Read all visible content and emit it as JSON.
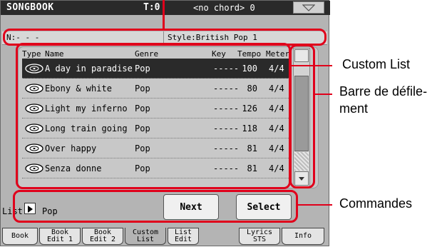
{
  "titlebar": {
    "title": "SONGBOOK",
    "tempo_letter": "T:",
    "tempo_value": "0",
    "chord": "<no chord> 0"
  },
  "infobar": {
    "n_label": "N:- - -",
    "style_label": "Style:British Pop 1"
  },
  "columns": {
    "type": "Type",
    "name": "Name",
    "genre": "Genre",
    "key": "Key",
    "tempo": "Tempo",
    "meter": "Meter"
  },
  "rows": [
    {
      "name": "A day in paradise",
      "genre": "Pop",
      "key": "-----",
      "tempo": "100",
      "meter": "4/4",
      "selected": true
    },
    {
      "name": "Ebony & white",
      "genre": "Pop",
      "key": "-----",
      "tempo": "80",
      "meter": "4/4",
      "selected": false
    },
    {
      "name": "Light my inferno",
      "genre": "Pop",
      "key": "-----",
      "tempo": "126",
      "meter": "4/4",
      "selected": false
    },
    {
      "name": "Long train going",
      "genre": "Pop",
      "key": "-----",
      "tempo": "118",
      "meter": "4/4",
      "selected": false
    },
    {
      "name": "Over happy",
      "genre": "Pop",
      "key": "-----",
      "tempo": "81",
      "meter": "4/4",
      "selected": false
    },
    {
      "name": "Senza donne",
      "genre": "Pop",
      "key": "-----",
      "tempo": "81",
      "meter": "4/4",
      "selected": false
    }
  ],
  "bottom": {
    "list_label": "List:",
    "list_value": "Pop",
    "next_label": "Next",
    "select_label": "Select"
  },
  "tabs": [
    "Book",
    "Book\nEdit 1",
    "Book\nEdit 2",
    "Custom\nList",
    "List\nEdit",
    "Lyrics\nSTS",
    "Info"
  ],
  "annotations": {
    "custom_list": "Custom List",
    "scrollbar_line1": "Barre de défile-",
    "scrollbar_line2": "ment",
    "commands": "Commandes"
  },
  "colors": {
    "highlight": "#e0001b",
    "selected_row": "#2a2a2a",
    "screen_bg": "#b4b4b4"
  }
}
